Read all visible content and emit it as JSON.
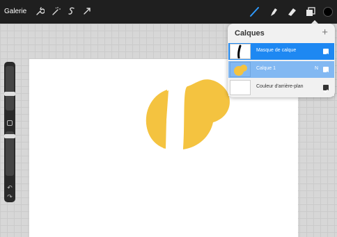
{
  "toolbar": {
    "gallery_label": "Galerie",
    "left_icons": [
      "wrench-icon",
      "magic-wand-icon",
      "selection-icon",
      "transform-icon"
    ],
    "right_icons": [
      "brush-icon",
      "smudge-icon",
      "eraser-icon",
      "layers-icon",
      "color-swatch-icon"
    ]
  },
  "layers_panel": {
    "title": "Calques",
    "add_glyph": "+",
    "layers": [
      {
        "name": "Masque de calque",
        "selected": true,
        "visible": true
      },
      {
        "name": "Calque 1",
        "blend_mark": "N",
        "selected": false,
        "visible": true
      },
      {
        "name": "Couleur d'arrière-plan",
        "selected": false,
        "visible": true
      }
    ]
  },
  "sidebar": {
    "undo_glyph": "↶",
    "redo_glyph": "↷"
  },
  "colors": {
    "accent_blue": "#1E88F2",
    "secondary_blue": "#82B8F2",
    "artwork_yellow": "#F4C340",
    "current_color": "#000000"
  }
}
